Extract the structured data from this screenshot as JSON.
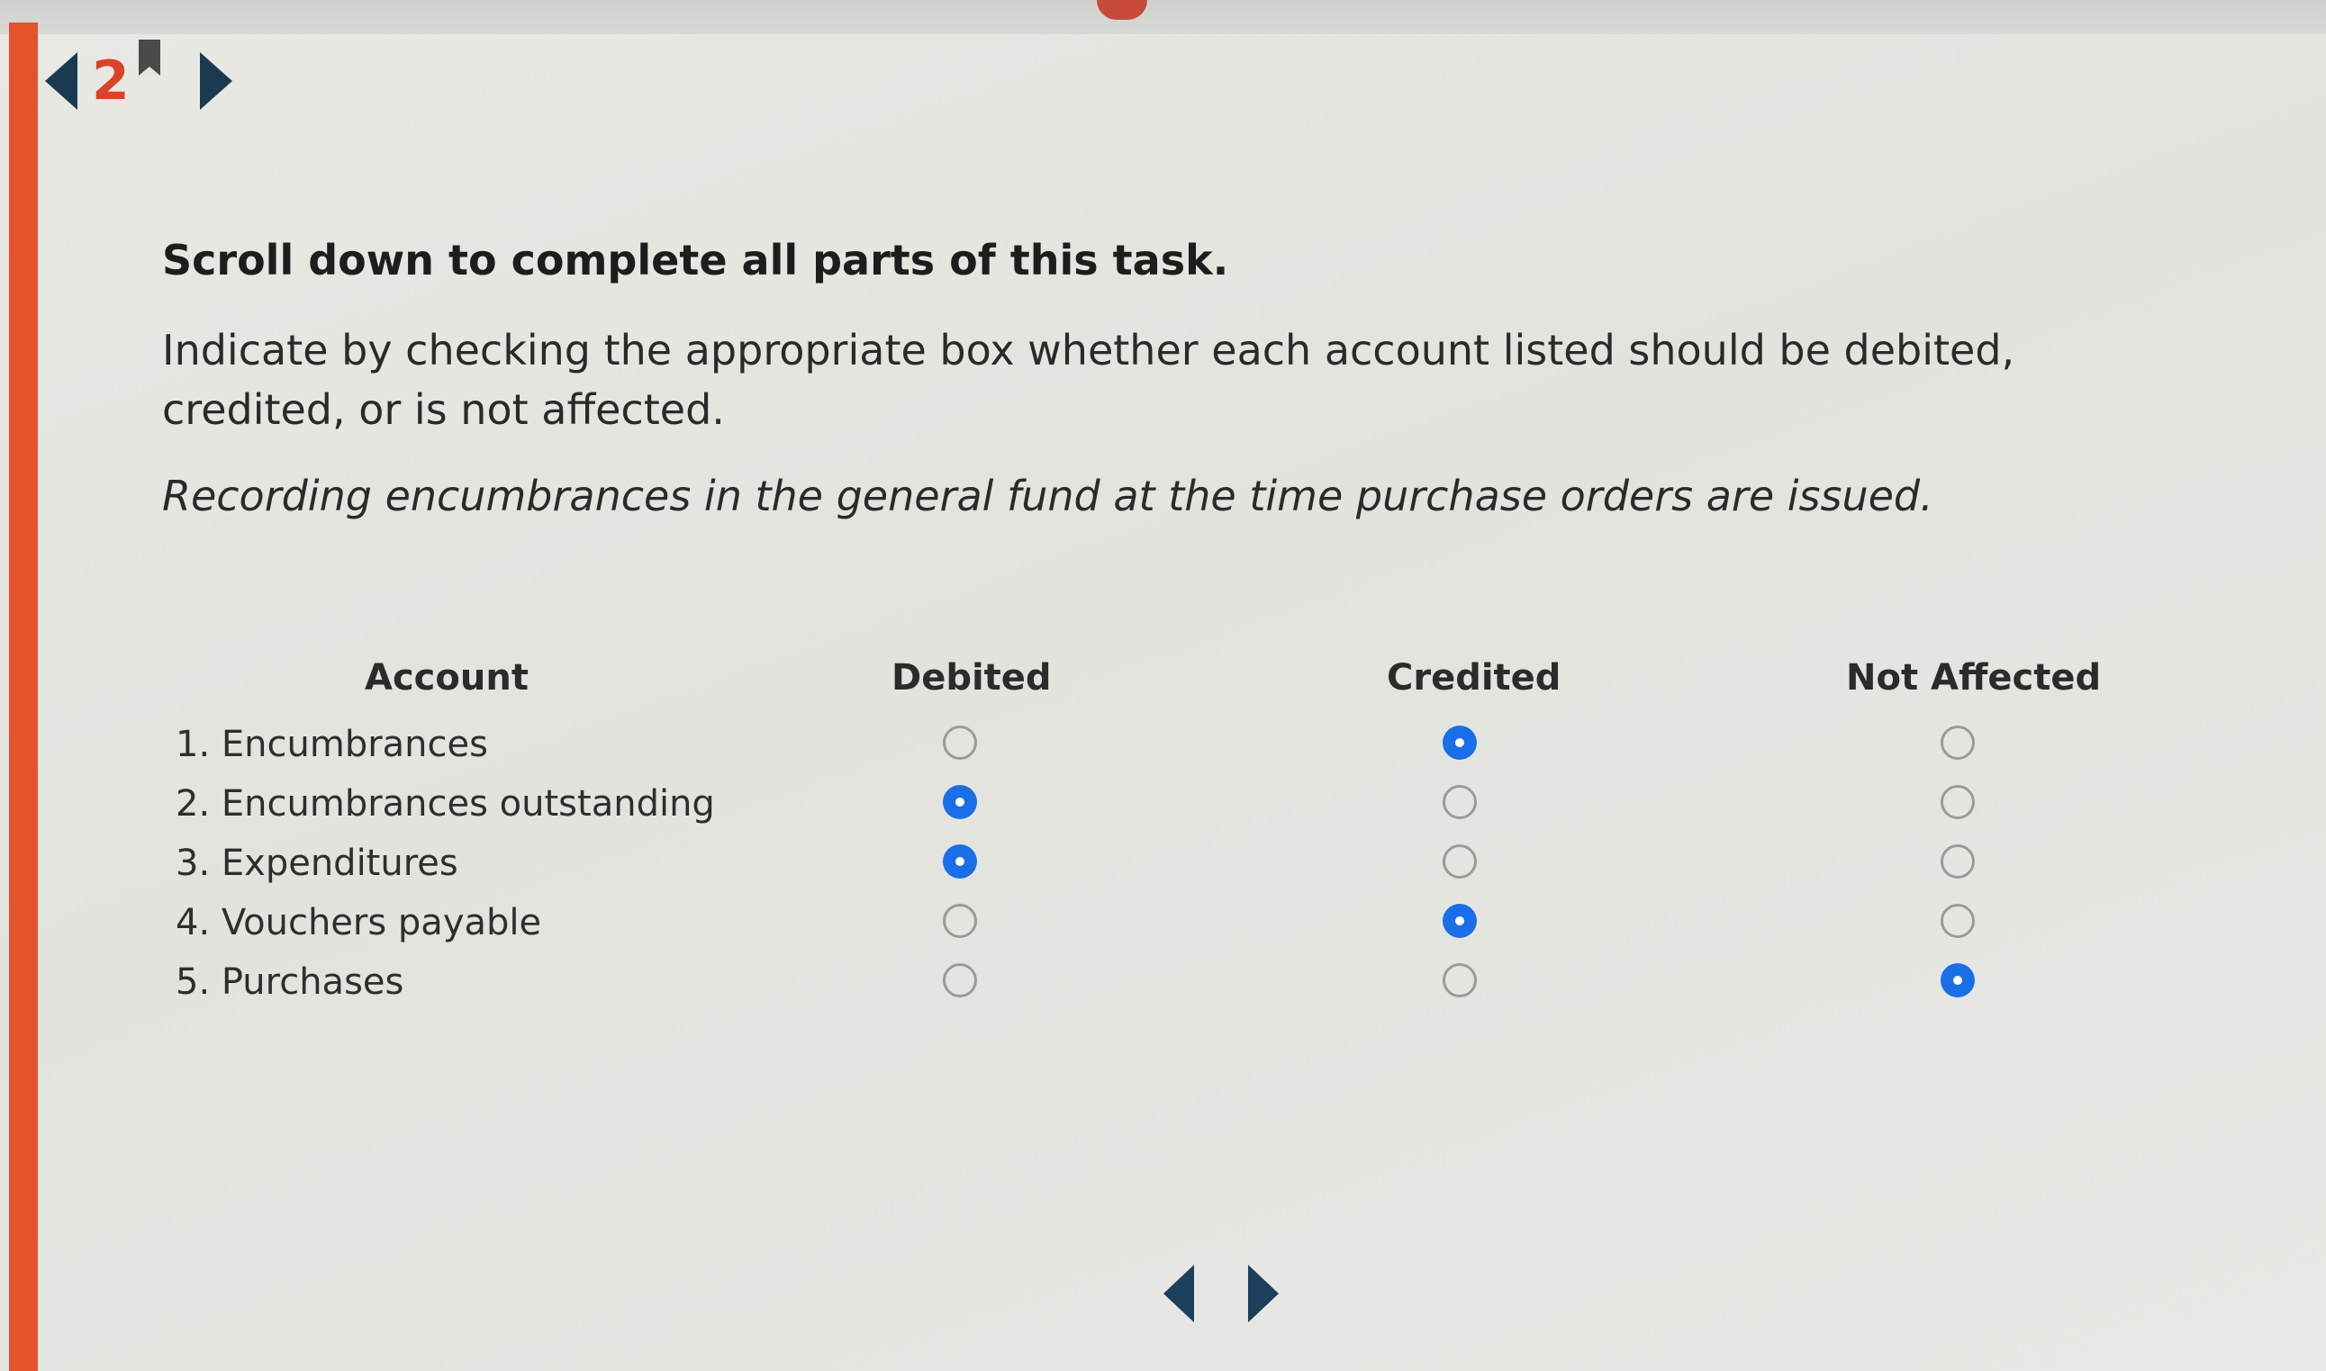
{
  "question_nav": {
    "number": "2",
    "prev_icon": "triangle-left",
    "next_icon": "triangle-right",
    "bookmark_icon": "bookmark"
  },
  "instructions": {
    "scroll_notice": "Scroll down to complete all parts of this task.",
    "task": "Indicate by checking the appropriate box whether each account listed should be debited, credited, or is not affected.",
    "scenario": "Recording encumbrances in the general fund at the time purchase orders are issued."
  },
  "table": {
    "headers": {
      "account": "Account",
      "debited": "Debited",
      "credited": "Credited",
      "not_affected": "Not Affected"
    },
    "rows": [
      {
        "account": "1. Encumbrances",
        "selected": "credited"
      },
      {
        "account": "2. Encumbrances outstanding",
        "selected": "debited"
      },
      {
        "account": "3. Expenditures",
        "selected": "debited"
      },
      {
        "account": "4. Vouchers payable",
        "selected": "credited"
      },
      {
        "account": "5. Purchases",
        "selected": "not_affected"
      }
    ]
  },
  "colors": {
    "accent_stripe": "#e4532b",
    "question_number": "#d9432a",
    "radio_selected": "#1a6ee8",
    "nav_arrow": "#1a3a52"
  }
}
